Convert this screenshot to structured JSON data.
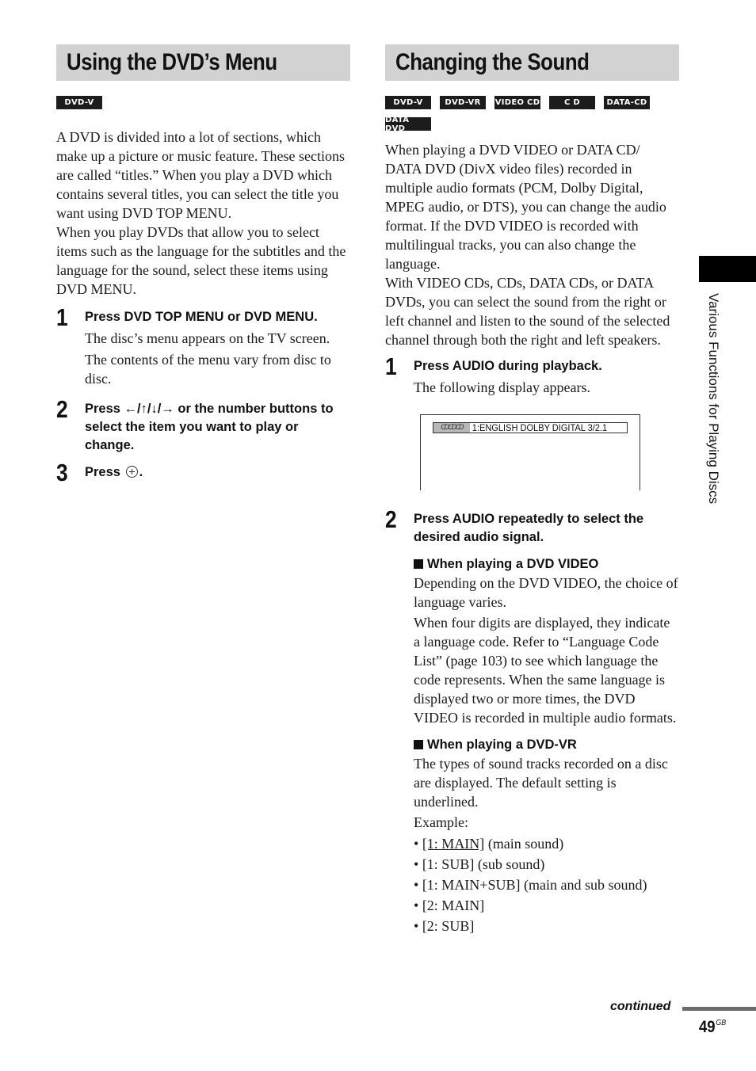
{
  "left": {
    "title": "Using the DVD’s Menu",
    "badges": [
      "DVD-V"
    ],
    "intro_paragraphs": [
      "A DVD is divided into a lot of sections, which make up a picture or music feature. These sections are called “titles.” When you play a DVD which contains several titles, you can select the title you want using DVD TOP MENU.",
      "When you play DVDs that allow you to select items such as the language for the subtitles and the language for the sound, select these items using DVD MENU."
    ],
    "steps": [
      {
        "number": "1",
        "heading": "Press DVD TOP MENU or DVD MENU.",
        "body": [
          "The disc’s menu appears on the TV screen.",
          "The contents of the menu vary from disc to disc."
        ]
      },
      {
        "number": "2",
        "heading": "Press ←/↑/↓/→ or the number buttons to select the item you want to play or change."
      },
      {
        "number": "3",
        "heading_prefix": "Press",
        "heading_suffix": ".",
        "icon": "enter-circle-plus-icon"
      }
    ]
  },
  "right": {
    "title": "Changing the Sound",
    "badges": [
      "DVD-V",
      "DVD-VR",
      "VIDEO CD",
      "C D",
      "DATA-CD",
      "DATA DVD"
    ],
    "intro_paragraphs": [
      "When playing a DVD VIDEO or DATA CD/ DATA DVD (DivX video files) recorded in multiple audio formats (PCM, Dolby Digital, MPEG audio, or DTS), you can change the audio format. If the DVD VIDEO is recorded with multilingual tracks, you can also change the language.",
      "With VIDEO CDs, CDs, DATA CDs, or DATA DVDs, you can select the sound from the right or left channel and listen to the sound of the selected channel through both the right and left speakers."
    ],
    "step1": {
      "number": "1",
      "heading": "Press AUDIO during playback.",
      "body": "The following display appears.",
      "display": {
        "icon": "audio-disc-icon",
        "text": "1:ENGLISH  DOLBY DIGITAL 3/2.1"
      }
    },
    "step2": {
      "number": "2",
      "heading": "Press AUDIO repeatedly to select the desired audio signal.",
      "sub_dvd_video": {
        "heading": "When playing a DVD VIDEO",
        "paragraphs": [
          "Depending on the DVD VIDEO, the choice of language varies.",
          "When four digits are displayed, they indicate a language code. Refer to “Language Code List” (page 103) to see which language the code represents. When the same language is displayed two or more times, the DVD VIDEO is recorded in multiple audio formats."
        ]
      },
      "sub_dvd_vr": {
        "heading": "When playing a DVD-VR",
        "paragraph": "The types of sound tracks recorded on a disc are displayed. The default setting is underlined.",
        "example_label": "Example:",
        "items": [
          {
            "code": "[1: MAIN]",
            "desc": " (main sound)",
            "default": true
          },
          {
            "code": "[1: SUB]",
            "desc": " (sub sound)",
            "default": false
          },
          {
            "code": "[1: MAIN+SUB]",
            "desc": " (main and sub sound)",
            "default": false
          },
          {
            "code": "[2: MAIN]",
            "desc": "",
            "default": false
          },
          {
            "code": "[2: SUB]",
            "desc": "",
            "default": false
          }
        ]
      }
    }
  },
  "side_tab": {
    "label": "Various Functions for Playing Discs"
  },
  "footer": {
    "continued": "continued",
    "page_number": "49",
    "page_suffix": "GB"
  }
}
